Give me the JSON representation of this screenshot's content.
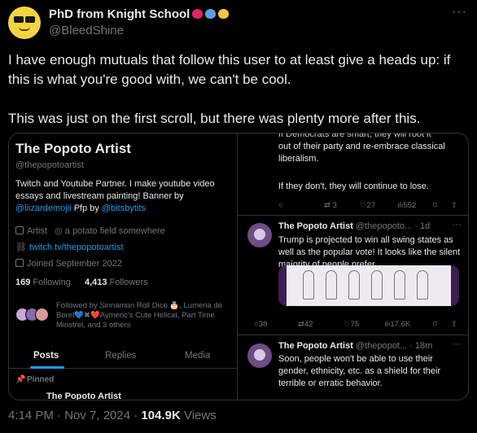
{
  "author": {
    "name": "PhD from Knight School",
    "handle": "@BleedShine",
    "emoji_colors": [
      "#e0245e",
      "#5aa0e8",
      "#f5c542"
    ],
    "more_icon": "more-icon"
  },
  "tweet": {
    "text": "I have enough mutuals that follow this user to at least give a heads up: if this is what you're good with, we can't be cool.\n\nThis was just on the first scroll, but there was plenty more after this.",
    "time": "4:14 PM · Nov 7, 2024 · ",
    "views_count": "104.9K",
    "views_label": " Views"
  },
  "profile": {
    "name": "The Popoto Artist",
    "handle": "@thepopotoartist",
    "bio_text": "Twitch and Youtube Partner.  I make youtube video essays and livestream painting!  Banner by ",
    "bio_link1": "@liizardemojii",
    "bio_mid": " Pfp by ",
    "bio_link2": "@bitsbytits",
    "category": "Artist",
    "location": "a potato field somewhere",
    "website": "twitch.tv/thepopotoartist",
    "joined": "Joined September 2022",
    "following_count": "169",
    "following_label": " Following",
    "followers_count": "4,413",
    "followers_label": " Followers",
    "followed_by": "Followed by Sinnamon Roll Dice 🎂, Lumeria de Borel💙✖❤️Aymeric's Cute Hellcat, Part Time Minstrel, and 3 others",
    "tabs": [
      "Posts",
      "Replies",
      "Media"
    ],
    "pinned": "Pinned",
    "cutoff_name": "The Popoto Artist"
  },
  "right_column": {
    "top_fragment_1": "If Democrats are smart, they will root it",
    "top_fragment_2": "out of their party and re-embrace classical liberalism.",
    "top_fragment_3": "If they don't, they will continue to lose.",
    "top_actions": {
      "retweets": "3",
      "likes": "27",
      "views": "552"
    },
    "tweet2": {
      "name": "The Popoto Artist",
      "handle": " @thepopoto... · 1d",
      "text": "Trump is projected to win all swing states as well as the popular vote! It looks like the silent majority of people prefer",
      "actions": {
        "replies": "38",
        "retweets": "42",
        "likes": "75",
        "views": "17.6K"
      }
    },
    "tweet3": {
      "name": "The Popoto Artist",
      "handle": " @thepopot... · 18m",
      "text": "Soon, people won't be able to use their gender, ethnicity, etc. as a shield for their terrible or erratic behavior."
    }
  }
}
